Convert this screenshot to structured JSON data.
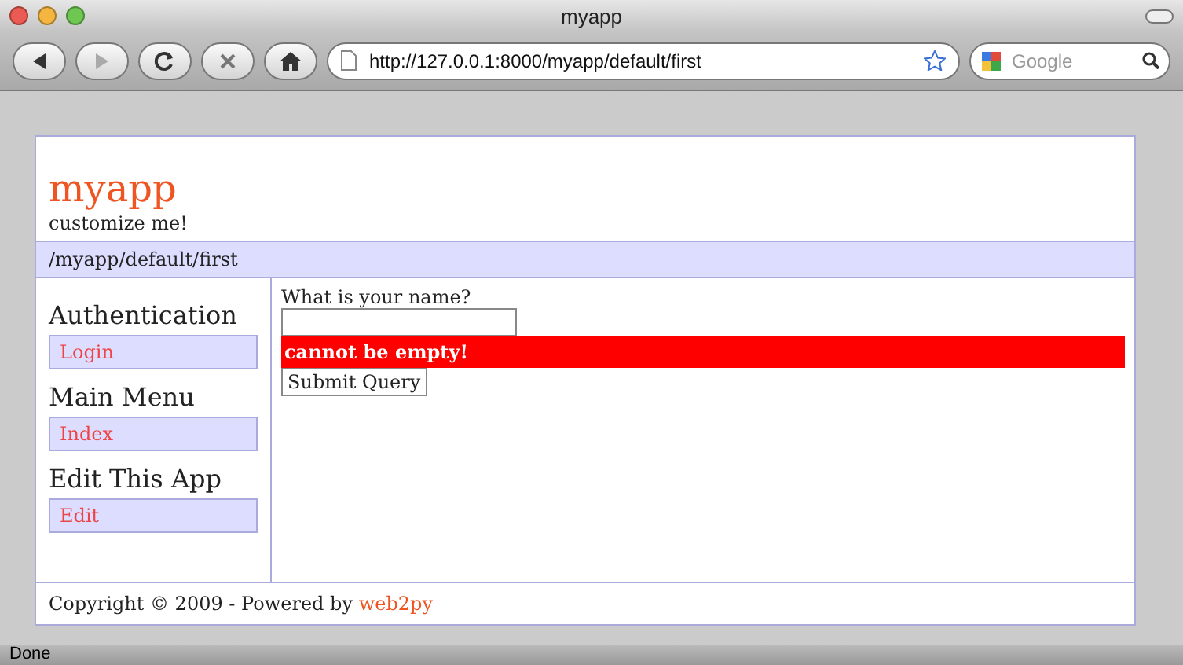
{
  "window": {
    "title": "myapp"
  },
  "toolbar": {
    "url": "http://127.0.0.1:8000/myapp/default/first",
    "search": {
      "placeholder": "Google"
    }
  },
  "header": {
    "title": "myapp",
    "subtitle": "customize me!"
  },
  "breadcrumb": "/myapp/default/first",
  "sidebar": [
    {
      "heading": "Authentication",
      "link": "Login"
    },
    {
      "heading": "Main Menu",
      "link": "Index"
    },
    {
      "heading": "Edit This App",
      "link": "Edit"
    }
  ],
  "form": {
    "label": "What is your name?",
    "error": "cannot be empty!",
    "submit": "Submit Query"
  },
  "footer": {
    "text": "Copyright © 2009 - Powered by ",
    "link": "web2py"
  },
  "status_bar": "Done"
}
